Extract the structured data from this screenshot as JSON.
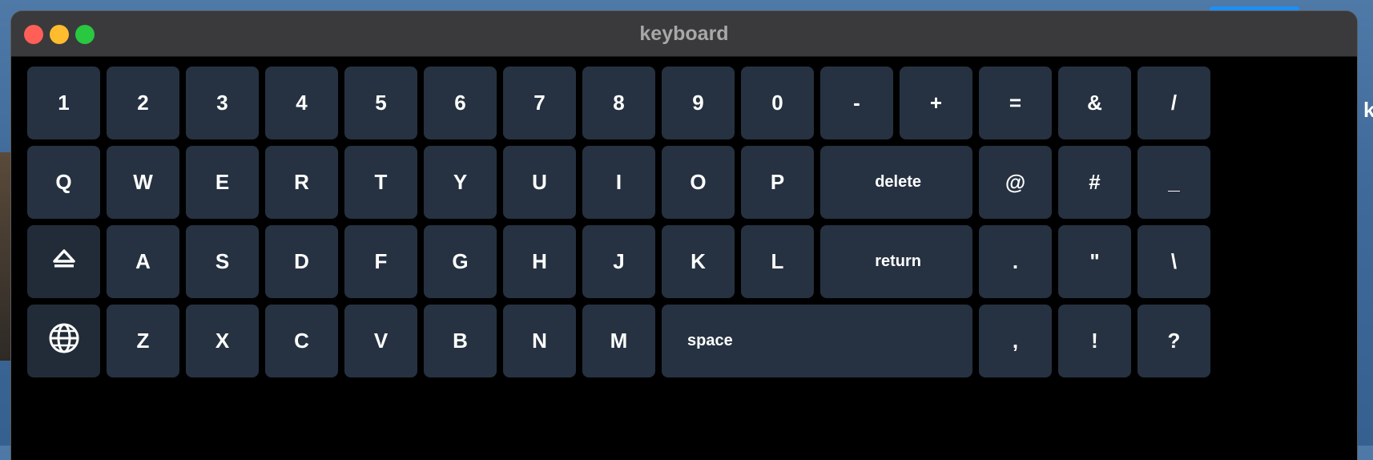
{
  "window": {
    "title": "keyboard"
  },
  "desktop": {
    "edge_letter": "k"
  },
  "keys": {
    "row1": [
      "1",
      "2",
      "3",
      "4",
      "5",
      "6",
      "7",
      "8",
      "9",
      "0",
      "-",
      "+",
      "=",
      "&",
      "/"
    ],
    "row2": [
      "Q",
      "W",
      "E",
      "R",
      "T",
      "Y",
      "U",
      "I",
      "O",
      "P",
      "delete",
      "@",
      "#",
      "_"
    ],
    "row3": [
      "shift",
      "A",
      "S",
      "D",
      "F",
      "G",
      "H",
      "J",
      "K",
      "L",
      "return",
      ".",
      "\"",
      "\\"
    ],
    "row4": [
      "globe",
      "Z",
      "X",
      "C",
      "V",
      "B",
      "N",
      "M",
      "space",
      ",",
      "!",
      "?"
    ]
  },
  "icons": {
    "shift": "shift-icon",
    "globe": "globe-icon"
  },
  "colors": {
    "key": "#263241",
    "window": "#000000",
    "titlebar": "#3a3a3c"
  }
}
